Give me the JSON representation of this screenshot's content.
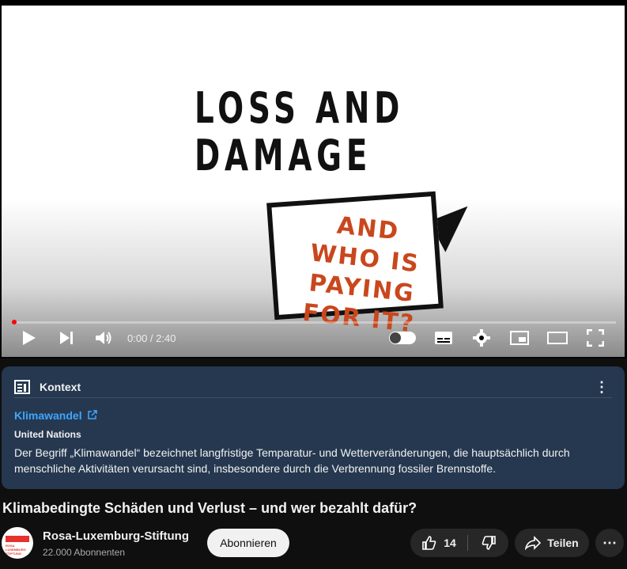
{
  "player": {
    "frame_title": "LOSS AND DAMAGE",
    "bubble_text": "AND WHO IS PAYING FOR IT?",
    "time": "0:00 / 2:40",
    "progress": 0.0,
    "icons": [
      "play-icon",
      "next-icon",
      "volume-icon",
      "autoplay-toggle",
      "subtitles-icon",
      "settings-icon",
      "miniplayer-icon",
      "theater-icon",
      "fullscreen-icon"
    ]
  },
  "context": {
    "title": "Kontext",
    "link": "Klimawandel",
    "source": "United Nations",
    "body": "Der Begriff „Klimawandel“ bezeichnet langfristige Temparatur- und Wetterveränderungen, die hauptsächlich durch menschliche Aktivitäten verursacht sind, insbesondere durch die Verbrennung fossiler Brennstoffe."
  },
  "video": {
    "title": "Klimabedingte Schäden und Verlust – und wer bezahlt dafür?"
  },
  "channel": {
    "name": "Rosa-Luxemburg-Stiftung",
    "subscribers": "22.000 Abonnenten",
    "avatar_text": "ROSA LUXEMBURG STIFTUNG"
  },
  "actions": {
    "subscribe": "Abonnieren",
    "likes": "14",
    "share": "Teilen",
    "more": "⋯"
  }
}
